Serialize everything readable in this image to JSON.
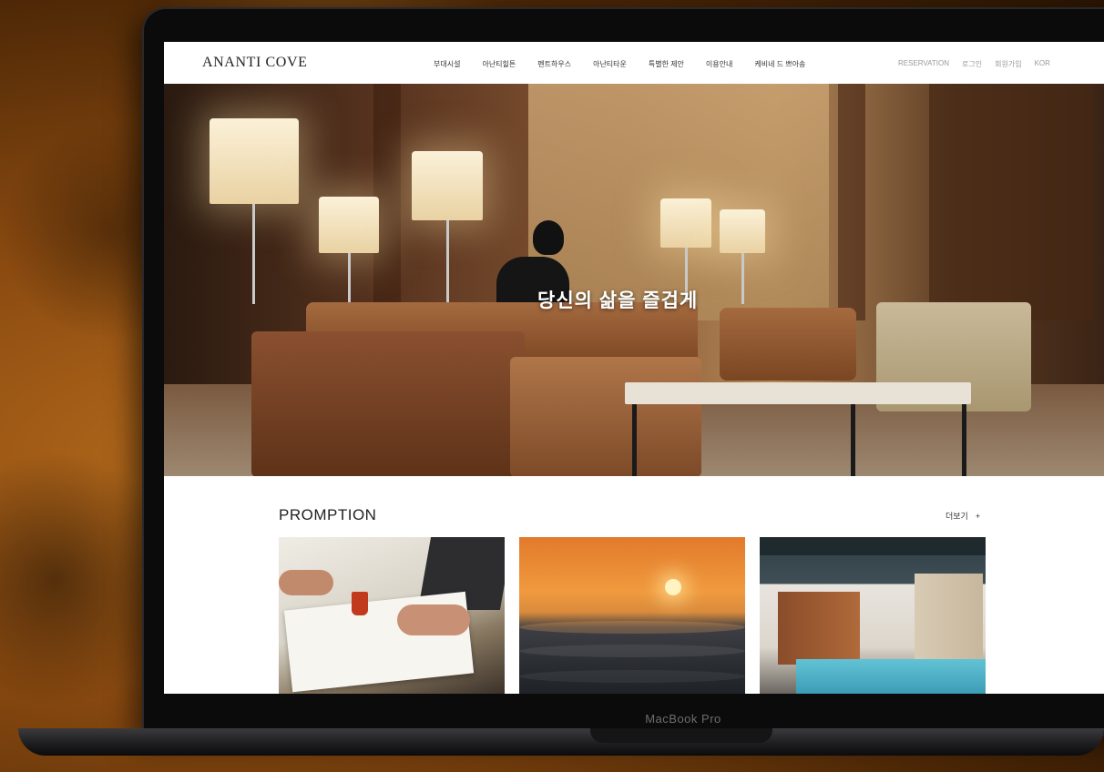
{
  "device": {
    "brand_label": "MacBook Pro"
  },
  "header": {
    "logo": "ANANTI COVE",
    "nav": [
      "부대시설",
      "아난티힐튼",
      "펜트하우스",
      "아난티타운",
      "특별한 제안",
      "이용안내",
      "케비네 드 쁘아송"
    ],
    "util": [
      "RESERVATION",
      "로그인",
      "회원가입",
      "KOR"
    ]
  },
  "hero": {
    "headline": "당신의 삶을 즐겁게"
  },
  "promotion": {
    "title": "PROMPTION",
    "more_label": "더보기",
    "more_icon": "+",
    "cards": [
      {
        "image": "meeting-workspace-photo"
      },
      {
        "image": "sunset-ocean-photo"
      },
      {
        "image": "indoor-pool-photo"
      }
    ]
  },
  "colors": {
    "accent_text": "#222222",
    "muted_text": "#999999",
    "background": "#ffffff"
  }
}
